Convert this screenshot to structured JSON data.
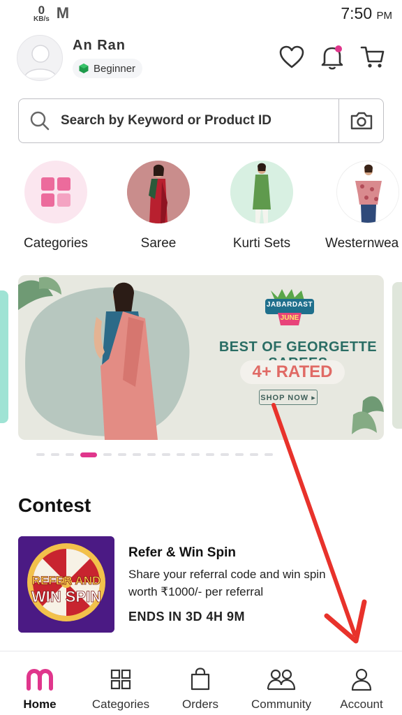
{
  "status_bar": {
    "net_speed_value": "0",
    "net_speed_unit": "KB/s",
    "mail_glyph": "M",
    "time": "7:50",
    "ampm": "PM"
  },
  "header": {
    "user_name": "An  Ran",
    "level_badge": "Beginner",
    "icons": [
      "wishlist-heart-icon",
      "notification-bell-icon",
      "cart-icon"
    ]
  },
  "search": {
    "placeholder": "Search by Keyword or Product ID",
    "icons": [
      "search-icon",
      "camera-icon"
    ]
  },
  "categories": [
    {
      "label": "Categories"
    },
    {
      "label": "Saree"
    },
    {
      "label": "Kurti Sets"
    },
    {
      "label": "Westernwea"
    }
  ],
  "banner": {
    "badge_line1": "JABARDAST",
    "badge_line2": "JUNE",
    "headline": "BEST OF GEORGETTE SAREES",
    "rating": "4+ RATED",
    "cta": "SHOP NOW ▸",
    "colors": {
      "background": "#e7e8e0",
      "headline": "#2a6d64",
      "rating": "#e06a65"
    }
  },
  "carousel": {
    "total_dots": 16,
    "active_index": 3
  },
  "contest": {
    "section_title": "Contest",
    "card": {
      "image_line1": "REFER AND",
      "image_line2": "WIN SPIN",
      "title": "Refer & Win Spin",
      "description": "Share your referral code and win spin worth ₹1000/- per referral",
      "ends": "ENDS IN 3D 4H 9M"
    }
  },
  "bottom_nav": {
    "items": [
      {
        "label": "Home",
        "icon": "meesho-m-icon",
        "active": true
      },
      {
        "label": "Categories",
        "icon": "grid-icon",
        "active": false
      },
      {
        "label": "Orders",
        "icon": "shopping-bag-icon",
        "active": false
      },
      {
        "label": "Community",
        "icon": "people-icon",
        "active": false
      },
      {
        "label": "Account",
        "icon": "user-icon",
        "active": false
      }
    ],
    "colors": {
      "accent": "#e0368c"
    }
  },
  "annotation": {
    "arrow_color": "#e8322b"
  }
}
